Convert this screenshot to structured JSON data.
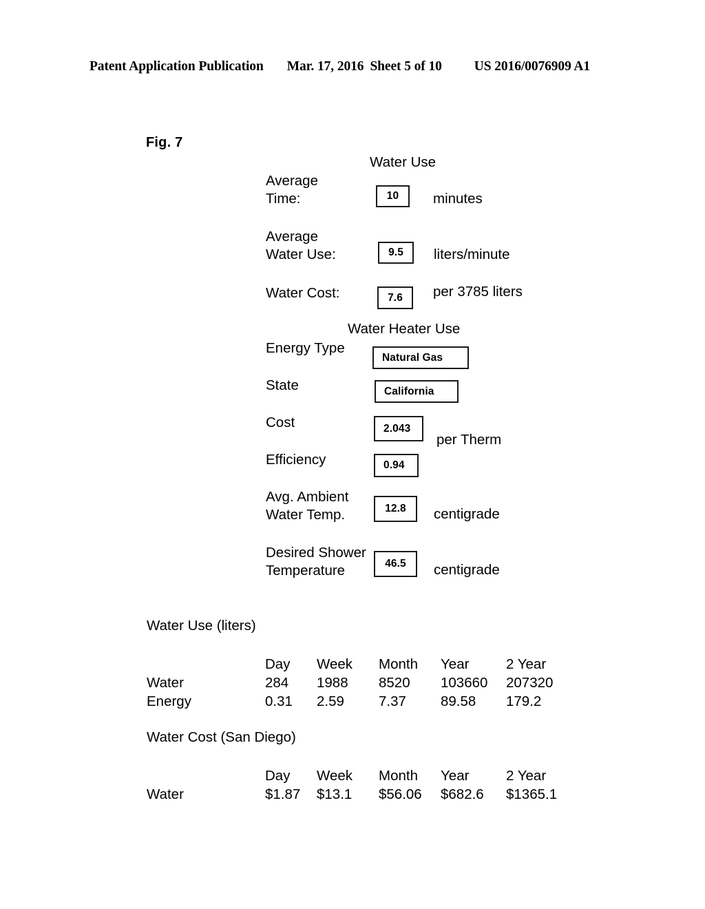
{
  "header": {
    "publication": "Patent Application Publication",
    "date": "Mar. 17, 2016",
    "sheet": "Sheet 5 of 10",
    "number": "US 2016/0076909 A1"
  },
  "figure": {
    "label": "Fig. 7"
  },
  "water_use_section": {
    "title": "Water Use",
    "fields": [
      {
        "label": "Average\nTime:",
        "value": "10",
        "unit": "minutes"
      },
      {
        "label": "Average\nWater Use:",
        "value": "9.5",
        "unit": "liters/minute"
      },
      {
        "label": "Water Cost:",
        "value": "7.6",
        "unit": "per 3785 liters"
      }
    ]
  },
  "water_heater_section": {
    "title": "Water Heater Use",
    "fields": [
      {
        "label": "Energy Type",
        "value": "Natural Gas",
        "unit": ""
      },
      {
        "label": "State",
        "value": "California",
        "unit": ""
      },
      {
        "label": "Cost",
        "value": "2.043",
        "unit": "per Therm"
      },
      {
        "label": "Efficiency",
        "value": "0.94",
        "unit": ""
      },
      {
        "label": "Avg. Ambient\nWater Temp.",
        "value": "12.8",
        "unit": "centigrade"
      },
      {
        "label": "Desired Shower\nTemperature",
        "value": "46.5",
        "unit": "centigrade"
      }
    ]
  },
  "water_use_table": {
    "caption": "Water Use (liters)",
    "columns": [
      "Day",
      "Week",
      "Month",
      "Year",
      "2 Year"
    ],
    "rows": [
      {
        "name": "Water",
        "values": [
          "284",
          "1988",
          "8520",
          "103660",
          "207320"
        ]
      },
      {
        "name": "Energy",
        "values": [
          "0.31",
          "2.59",
          "7.37",
          "89.58",
          "179.2"
        ]
      }
    ]
  },
  "water_cost_table": {
    "caption": "Water Cost (San Diego)",
    "columns": [
      "Day",
      "Week",
      "Month",
      "Year",
      "2 Year"
    ],
    "rows": [
      {
        "name": "Water",
        "values": [
          "$1.87",
          "$13.1",
          "$56.06",
          "$682.6",
          "$1365.1"
        ]
      }
    ]
  }
}
